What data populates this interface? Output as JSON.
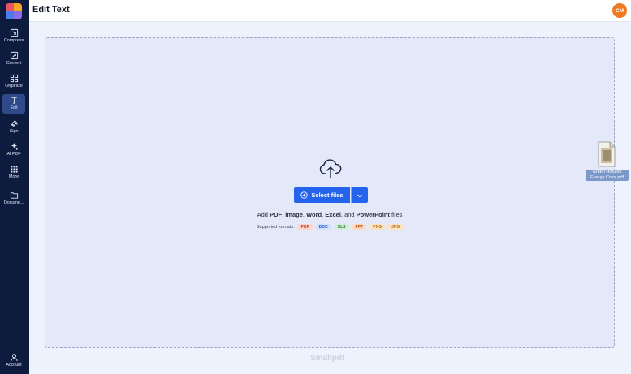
{
  "sidebar": {
    "items": [
      {
        "label": "Compress",
        "icon": "compress-icon"
      },
      {
        "label": "Convert",
        "icon": "convert-icon"
      },
      {
        "label": "Organize",
        "icon": "grid-icon"
      },
      {
        "label": "Edit",
        "icon": "text-cursor-icon",
        "active": true
      },
      {
        "label": "Sign",
        "icon": "pen-sign-icon"
      },
      {
        "label": "AI PDF",
        "icon": "sparkle-icon"
      },
      {
        "label": "More",
        "icon": "apps-grid-icon"
      },
      {
        "label": "Docume...",
        "icon": "folder-icon"
      }
    ],
    "account_label": "Account"
  },
  "header": {
    "title": "Edit Text",
    "avatar_initials": "CM",
    "avatar_color": "#f07a24"
  },
  "dropzone": {
    "select_label": "Select files",
    "add_prefix": "Add ",
    "add_types": [
      "PDF",
      "image",
      "Word",
      "Excel",
      "PowerPoint"
    ],
    "add_separators": [
      ", ",
      ", ",
      ", ",
      ", and "
    ],
    "add_suffix": " files",
    "supported_label": "Supported formats:",
    "formats": [
      "PDF",
      "DOC",
      "XLS",
      "PPT",
      "PNG",
      "JPG"
    ]
  },
  "brand": "Smallpdf",
  "desktop_file": {
    "name": "Green Horizon Energy Color.pdf"
  },
  "colors": {
    "accent": "#2463eb",
    "sidebar": "#0d1b3e"
  }
}
